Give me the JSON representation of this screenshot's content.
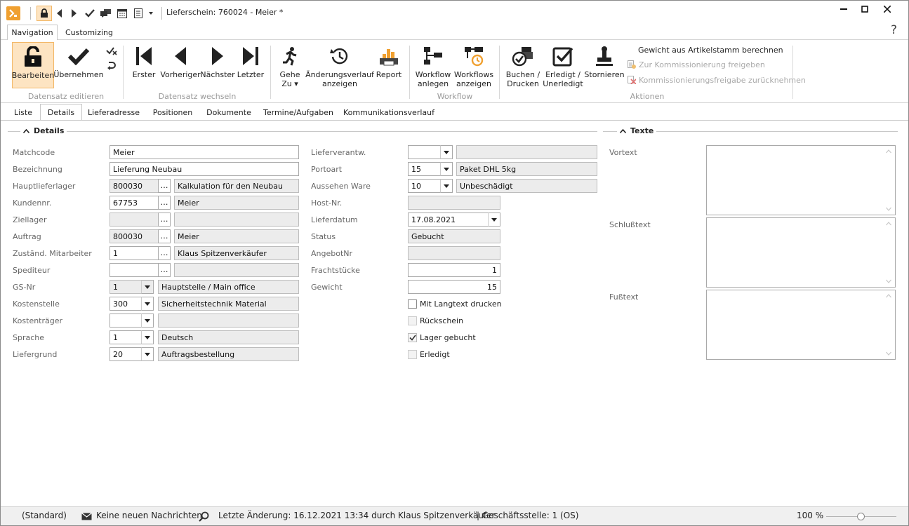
{
  "titlebar": {
    "title": "Lieferschein: 760024 - Meier *",
    "icons": [
      "app-logo-icon",
      "lock-icon",
      "prev-arrow-icon",
      "next-arrow-icon",
      "check-icon",
      "chat-icon",
      "calendar-icon",
      "list-icon",
      "dropdown-icon"
    ],
    "minimize": "—",
    "maximize": "☐",
    "close": "✕"
  },
  "menu": {
    "tabs": [
      "Navigation",
      "Customizing"
    ],
    "help": "?"
  },
  "ribbon": {
    "buttons": {
      "bearbeiten": "Bearbeiten",
      "uebernehmen": "Übernehmen",
      "erster": "Erster",
      "vorheriger": "Vorheriger",
      "naechster": "Nächster",
      "letzter": "Letzter",
      "gehe_zu_1": "Gehe",
      "gehe_zu_2": "Zu ▾",
      "aenderung_1": "Änderungsverlauf",
      "aenderung_2": "anzeigen",
      "report": "Report",
      "wf_anlegen_1": "Workflow",
      "wf_anlegen_2": "anlegen",
      "wf_anzeigen_1": "Workflows",
      "wf_anzeigen_2": "anzeigen",
      "buchen_1": "Buchen /",
      "buchen_2": "Drucken",
      "erledigt_1": "Erledigt /",
      "erledigt_2": "Unerledigt",
      "stornieren": "Stornieren"
    },
    "actions": {
      "gewicht": "Gewicht aus Artikelstamm berechnen",
      "freigeben": "Zur Kommissionierung freigeben",
      "zuruecknehmen": "Kommissionierungsfreigabe zurücknehmen"
    },
    "groups": {
      "edit": "Datensatz editieren",
      "switch": "Datensatz wechseln",
      "workflow": "Workflow",
      "aktionen": "Aktionen"
    }
  },
  "tabs": [
    "Liste",
    "Details",
    "Lieferadresse",
    "Positionen",
    "Dokumente",
    "Termine/Aufgaben",
    "Kommunikationsverlauf"
  ],
  "sections": {
    "details": "Details",
    "texte": "Texte"
  },
  "form": {
    "left": {
      "matchcode": {
        "label": "Matchcode",
        "value": "Meier"
      },
      "bezeichnung": {
        "label": "Bezeichnung",
        "value": "Lieferung Neubau"
      },
      "hauptlieferlager": {
        "label": "Hauptlieferlager",
        "value": "800030",
        "desc": "Kalkulation für den Neubau"
      },
      "kundennr": {
        "label": "Kundennr.",
        "value": "67753",
        "desc": "Meier"
      },
      "ziellager": {
        "label": "Ziellager",
        "value": "",
        "desc": ""
      },
      "auftrag": {
        "label": "Auftrag",
        "value": "800030",
        "desc": "Meier"
      },
      "mitarbeiter": {
        "label": "Zuständ. Mitarbeiter",
        "value": "1",
        "desc": "Klaus Spitzenverkäufer"
      },
      "spediteur": {
        "label": "Spediteur",
        "value": "",
        "desc": ""
      },
      "gsnr": {
        "label": "GS-Nr",
        "value": "1",
        "desc": "Hauptstelle / Main office"
      },
      "kostenstelle": {
        "label": "Kostenstelle",
        "value": "300",
        "desc": "Sicherheitstechnik Material"
      },
      "kostentraeger": {
        "label": "Kostenträger",
        "value": "",
        "desc": ""
      },
      "sprache": {
        "label": "Sprache",
        "value": "1",
        "desc": "Deutsch"
      },
      "liefergrund": {
        "label": "Liefergrund",
        "value": "20",
        "desc": "Auftragsbestellung"
      }
    },
    "mid": {
      "lieferverantw": {
        "label": "Lieferverantw.",
        "value": "",
        "desc": ""
      },
      "portoart": {
        "label": "Portoart",
        "value": "15",
        "desc": "Paket DHL 5kg"
      },
      "aussehen": {
        "label": "Aussehen Ware",
        "value": "10",
        "desc": "Unbeschädigt"
      },
      "hostnr": {
        "label": "Host-Nr.",
        "value": ""
      },
      "lieferdatum": {
        "label": "Lieferdatum",
        "value": "17.08.2021"
      },
      "status": {
        "label": "Status",
        "value": "Gebucht"
      },
      "angebotnr": {
        "label": "AngebotNr",
        "value": ""
      },
      "frachtstuecke": {
        "label": "Frachtstücke",
        "value": "1"
      },
      "gewicht": {
        "label": "Gewicht",
        "value": "15"
      }
    },
    "checks": {
      "langtext": {
        "label": "Mit Langtext drucken",
        "checked": false
      },
      "rueckschein": {
        "label": "Rückschein",
        "checked": false
      },
      "lager": {
        "label": "Lager gebucht",
        "checked": true
      },
      "erledigt": {
        "label": "Erledigt",
        "checked": false
      }
    },
    "texte": {
      "vortext": "Vortext",
      "schlusstext": "Schlußtext",
      "fusstext": "Fußtext"
    }
  },
  "statusbar": {
    "profile": "(Standard)",
    "messages": "Keine neuen Nachrichten",
    "last_change": "Letzte Änderung: 16.12.2021 13:34 durch Klaus Spitzenverkäufer",
    "branch": "| Geschäftsstelle:  1 (OS)",
    "zoom": "100 %",
    "zoom_level": 1.0
  },
  "colors": {
    "accent": "#f0a030",
    "active_button_bg": "#fde4c2",
    "active_button_border": "#f3b868"
  }
}
